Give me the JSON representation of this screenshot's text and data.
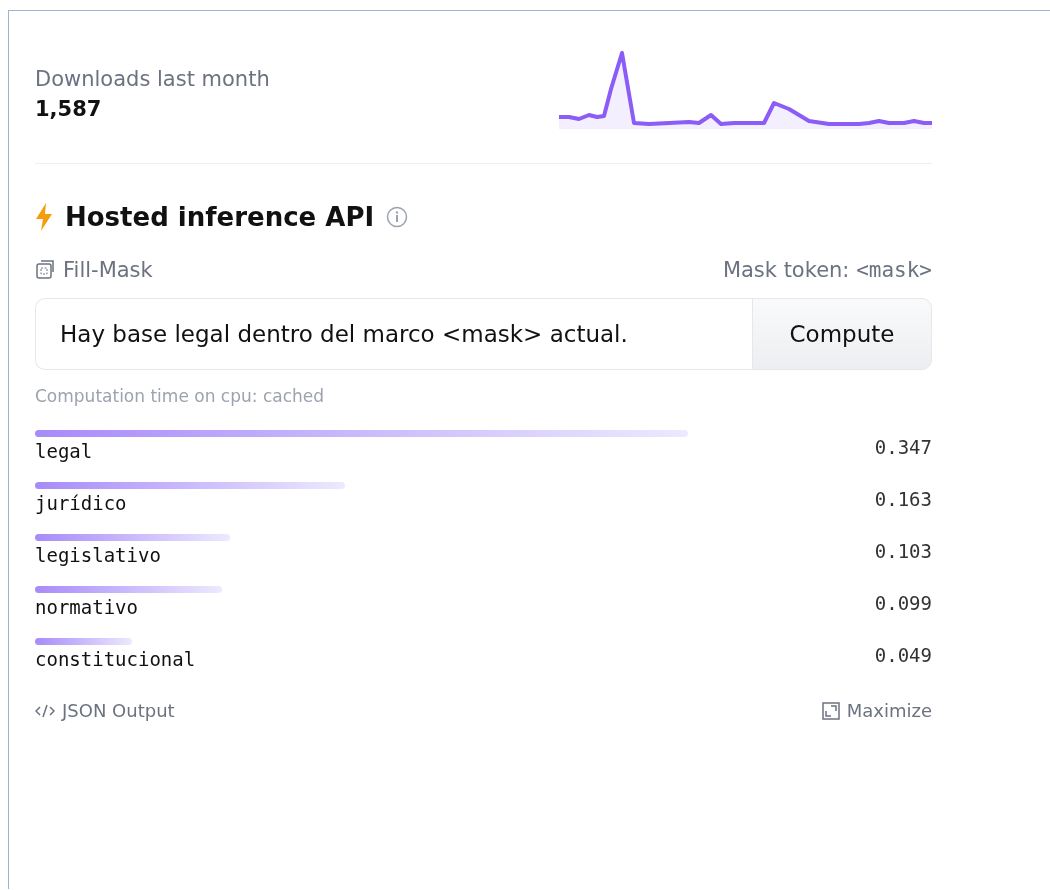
{
  "downloads": {
    "label": "Downloads last month",
    "count": "1,587"
  },
  "widget": {
    "title": "Hosted inference API",
    "task": "Fill-Mask",
    "mask_token_label": "Mask token:",
    "mask_token": "<mask>",
    "input_value": "Hay base legal dentro del marco <mask> actual.",
    "compute_button": "Compute",
    "computation_note": "Computation time on cpu: cached",
    "results": [
      {
        "label": "legal",
        "score": "0.347",
        "level": 0.728
      },
      {
        "label": "jurídico",
        "score": "0.163",
        "level": 0.346
      },
      {
        "label": "legislativo",
        "score": "0.103",
        "level": 0.217
      },
      {
        "label": "normativo",
        "score": "0.099",
        "level": 0.208
      },
      {
        "label": "constitucional",
        "score": "0.049",
        "level": 0.108
      }
    ],
    "json_output_link": "JSON Output",
    "maximize_link": "Maximize"
  }
}
